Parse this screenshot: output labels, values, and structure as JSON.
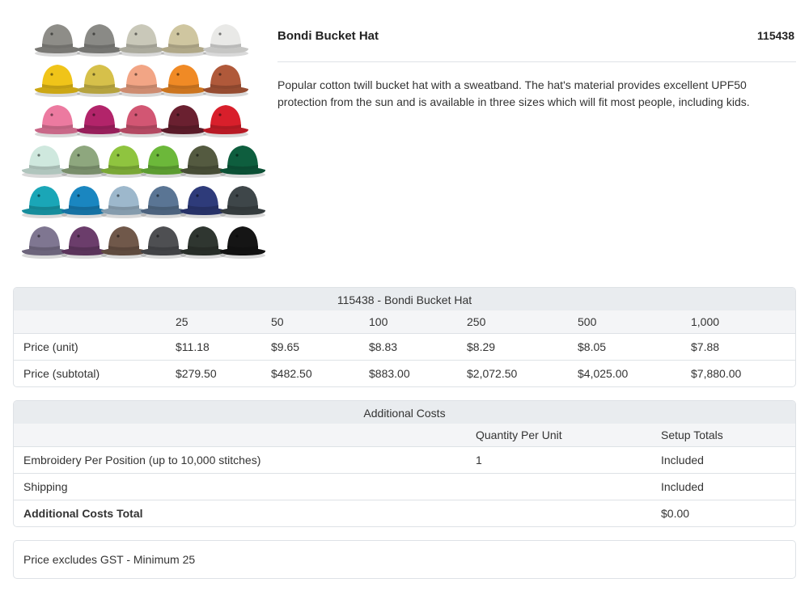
{
  "product": {
    "name": "Bondi Bucket Hat",
    "code": "115438",
    "description": "Popular cotton twill bucket hat with a sweatband. The hat's material provides excellent UPF50 protection from the sun and is available in three sizes which will fit most people, including kids."
  },
  "hat_colors": [
    [
      "#8e8d88",
      "#8a8a86",
      "#c9c8b9",
      "#cfc6a0",
      "#e9e9e7"
    ],
    [
      "#f0c419",
      "#d6c04a",
      "#f2a585",
      "#f08a25",
      "#b0593a"
    ],
    [
      "#ec7aa0",
      "#b2246a",
      "#d25673",
      "#6a2030",
      "#d81f2b"
    ],
    [
      "#cfe8de",
      "#8ea77e",
      "#8fc43f",
      "#6cb83a",
      "#545a40",
      "#0e5e3e"
    ],
    [
      "#1aa6b7",
      "#1a86c0",
      "#9db8cc",
      "#5a7594",
      "#2e3b7a",
      "#3e4649"
    ],
    [
      "#7f7691",
      "#6b3d6b",
      "#70584a",
      "#4e4f52",
      "#2f3630",
      "#151515"
    ]
  ],
  "pricing": {
    "title": "115438 - Bondi Bucket Hat",
    "quantities": [
      "25",
      "50",
      "100",
      "250",
      "500",
      "1,000"
    ],
    "rows": [
      {
        "label": "Price (unit)",
        "values": [
          "$11.18",
          "$9.65",
          "$8.83",
          "$8.29",
          "$8.05",
          "$7.88"
        ]
      },
      {
        "label": "Price (subtotal)",
        "values": [
          "$279.50",
          "$482.50",
          "$883.00",
          "$2,072.50",
          "$4,025.00",
          "$7,880.00"
        ]
      }
    ]
  },
  "additional": {
    "title": "Additional Costs",
    "headers": {
      "qty": "Quantity Per Unit",
      "setup": "Setup Totals"
    },
    "rows": [
      {
        "label": "Embroidery Per Position (up to 10,000 stitches)",
        "qty": "1",
        "setup": "Included"
      },
      {
        "label": "Shipping",
        "qty": "",
        "setup": "Included"
      }
    ],
    "total": {
      "label": "Additional Costs Total",
      "value": "$0.00"
    }
  },
  "note": "Price excludes GST - Minimum 25"
}
